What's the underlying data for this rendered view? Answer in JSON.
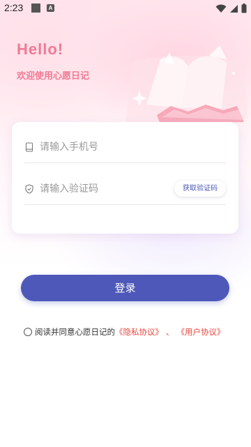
{
  "status_bar": {
    "time": "2:23",
    "notification_letter": "A"
  },
  "header": {
    "greeting": "Hello!",
    "subtitle": "欢迎使用心愿日记"
  },
  "form": {
    "phone_placeholder": "请输入手机号",
    "code_placeholder": "请输入验证码",
    "get_code_label": "获取验证码"
  },
  "login_label": "登录",
  "agreement": {
    "prefix": "阅读并同意心愿日记的",
    "privacy_link": "《隐私协议》",
    "separator": "、",
    "user_link": "《用户协议》"
  },
  "colors": {
    "accent_pink": "#f07a94",
    "primary_blue": "#4d58b8",
    "link_red": "#e8483f"
  }
}
